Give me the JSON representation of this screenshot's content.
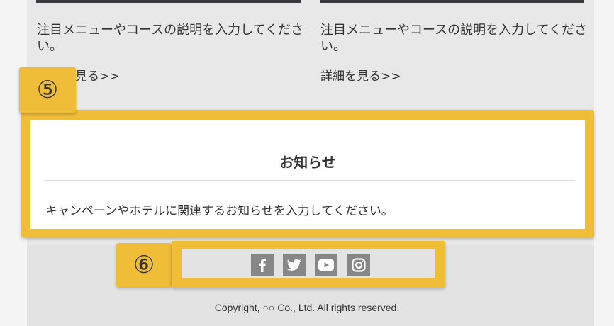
{
  "cards": [
    {
      "description": "注目メニューやコースの説明を入力してください。",
      "more_link": "見る>>"
    },
    {
      "description": "注目メニューやコースの説明を入力してください。",
      "more_link": "詳細を見る>>"
    }
  ],
  "badges": {
    "notice": "⑤",
    "social": "⑥"
  },
  "notice": {
    "title": "お知らせ",
    "body": "キャンペーンやホテルに関連するお知らせを入力してください。"
  },
  "social_icons": [
    "facebook-icon",
    "twitter-icon",
    "youtube-icon",
    "instagram-icon"
  ],
  "footer": {
    "copyright": "Copyright, ○○ Co., Ltd. All rights reserved."
  },
  "colors": {
    "highlight": "#f0bd38",
    "icon_bg": "#878787",
    "panel_bg": "#e8e8e8"
  }
}
